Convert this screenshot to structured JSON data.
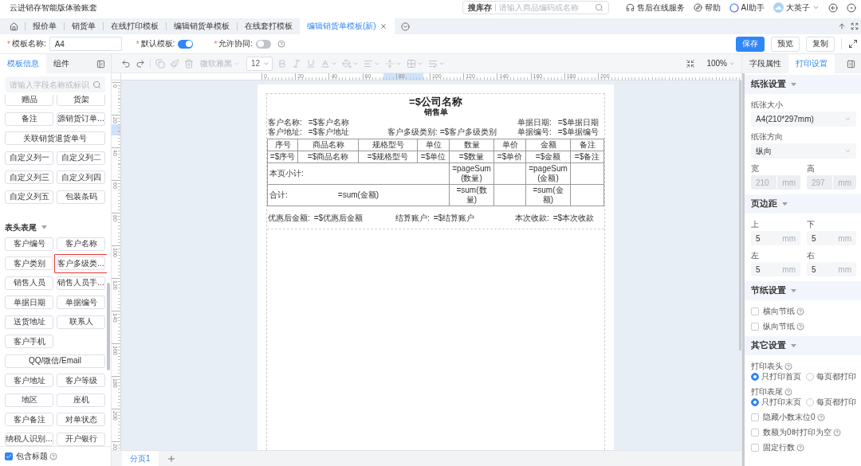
{
  "app": {
    "title": "云进销存智能版体验账套"
  },
  "header": {
    "search": {
      "scope": "搜库存",
      "placeholder": "请输入商品编码或名称"
    },
    "links": [
      {
        "label": "售后在线服务"
      },
      {
        "label": "帮助"
      },
      {
        "label": "AI助手"
      }
    ],
    "user": {
      "name": "大英子"
    }
  },
  "tabs": [
    {
      "label": "报价单",
      "selected": false
    },
    {
      "label": "销货单",
      "selected": false
    },
    {
      "label": "在线打印模板",
      "selected": false
    },
    {
      "label": "编辑销货单模板",
      "selected": false
    },
    {
      "label": "在线套打模板",
      "selected": false
    },
    {
      "label": "编辑销货单模板(新)",
      "selected": true
    }
  ],
  "template_form": {
    "fields": [
      {
        "kind": "input",
        "mark": "*",
        "label": "模板名称:",
        "value": "A4"
      },
      {
        "kind": "switch",
        "mark": "*",
        "label": "默认模板:",
        "on": true
      },
      {
        "kind": "switch",
        "mark": "*",
        "label": "允许协同:",
        "on": false,
        "help": true
      }
    ],
    "buttons": [
      {
        "label": "保存",
        "kind": "primary"
      },
      {
        "label": "预览",
        "kind": "default"
      },
      {
        "label": "复制",
        "kind": "default"
      }
    ]
  },
  "left_panel": {
    "tabs": [
      {
        "label": "模板信息",
        "selected": true
      },
      {
        "label": "组件",
        "selected": false
      }
    ],
    "search": {
      "placeholder": "请输入字段名称或标识"
    },
    "groups": [
      {
        "fields": [
          {
            "label": "赠品",
            "kind": "half",
            "highlighted": false
          },
          {
            "label": "货架",
            "kind": "half",
            "highlighted": false
          },
          {
            "label": "备注",
            "kind": "half",
            "highlighted": false
          },
          {
            "label": "源销货订单...",
            "kind": "half",
            "highlighted": false
          },
          {
            "label": "关联销货退货单号",
            "kind": "wide",
            "highlighted": false
          },
          {
            "label": "自定义列一",
            "kind": "half",
            "highlighted": false
          },
          {
            "label": "自定义列二",
            "kind": "half",
            "highlighted": false
          },
          {
            "label": "自定义列三",
            "kind": "half",
            "highlighted": false
          },
          {
            "label": "自定义列四",
            "kind": "half",
            "highlighted": false
          },
          {
            "label": "自定义列五",
            "kind": "half",
            "highlighted": false
          },
          {
            "label": "包装条码",
            "kind": "half",
            "highlighted": false
          }
        ]
      },
      {
        "title": "表头表尾",
        "expanded": true,
        "fields": [
          {
            "label": "客户编号",
            "kind": "half",
            "highlighted": false
          },
          {
            "label": "客户名称",
            "kind": "half",
            "highlighted": false
          },
          {
            "label": "客户类别",
            "kind": "half",
            "highlighted": false
          },
          {
            "label": "客户多级类...",
            "kind": "half",
            "highlighted": true
          },
          {
            "label": "销售人员",
            "kind": "half",
            "highlighted": false
          },
          {
            "label": "销售人员手...",
            "kind": "half",
            "highlighted": false
          },
          {
            "label": "单据日期",
            "kind": "half",
            "highlighted": false
          },
          {
            "label": "单据编号",
            "kind": "half",
            "highlighted": false
          },
          {
            "label": "送货地址",
            "kind": "half",
            "highlighted": false
          },
          {
            "label": "联系人",
            "kind": "half",
            "highlighted": false
          },
          {
            "label": "客户手机",
            "kind": "half",
            "highlighted": false
          },
          {
            "label": "QQ/微信/Email",
            "kind": "wide",
            "highlighted": false
          },
          {
            "label": "客户地址",
            "kind": "half",
            "highlighted": false
          },
          {
            "label": "客户等级",
            "kind": "half",
            "highlighted": false
          },
          {
            "label": "地区",
            "kind": "half",
            "highlighted": false
          },
          {
            "label": "座机",
            "kind": "half",
            "highlighted": false
          },
          {
            "label": "客户备注",
            "kind": "half",
            "highlighted": false
          },
          {
            "label": "对单状态",
            "kind": "half",
            "highlighted": false
          },
          {
            "label": "纳税人识别...",
            "kind": "half",
            "highlighted": false
          },
          {
            "label": "开户银行",
            "kind": "half",
            "highlighted": false
          }
        ]
      }
    ],
    "include_title": {
      "label": "包含标题",
      "checked": true,
      "help": true
    }
  },
  "editor": {
    "toolbar": {
      "font": {
        "value": "微软雅黑",
        "disabled": true
      },
      "size": "12",
      "zoom": "100%"
    },
    "rulers": {
      "horizontal": [
        "0",
        "20",
        "40",
        "60",
        "80",
        "100",
        "120",
        "140",
        "160",
        "180",
        "200"
      ],
      "vertical": [
        "0",
        "20",
        "40",
        "60",
        "80",
        "100",
        "120",
        "140",
        "160",
        "180",
        "200",
        "20"
      ]
    },
    "document": {
      "title": "=$公司名称",
      "subtitle": "销售单",
      "info_rows": [
        {
          "left": {
            "label": "客户名称:",
            "value": "=$客户名称"
          },
          "right": {
            "label": "单据日期:",
            "value": "=$单据日期"
          }
        },
        {
          "left": {
            "label": "客户地址:",
            "value": "=$客户地址"
          },
          "center": {
            "label": "客户多级类别:",
            "value": "=$客户多级类别"
          },
          "right": {
            "label": "单据编号:",
            "value": "=$单据编号"
          }
        }
      ],
      "table": {
        "columns": [
          "序号",
          "商品名称",
          "规格型号",
          "单位",
          "数量",
          "单价",
          "金额",
          "备注"
        ],
        "rows": [
          {
            "kind": "data",
            "cells": [
              "=$序号",
              "=$商品名称",
              "=$规格型号",
              "=$单位",
              "=$数量",
              "=$单价",
              "=$金额",
              "=$备注"
            ]
          },
          {
            "kind": "summary",
            "label": "本页小计:",
            "quantity": "=pageSum(数量)",
            "amount": "=pageSum(金额)"
          },
          {
            "kind": "summary",
            "label": "合计:",
            "label_value": "=sum(金额)",
            "quantity": "=sum(数量)",
            "amount": "=sum(金额)"
          }
        ]
      },
      "footer": [
        {
          "label": "优惠后金额:",
          "value": "=$优惠后金额"
        },
        {
          "label": "结算账户:",
          "value": "=$结算账户"
        },
        {
          "label": "本次收款:",
          "value": "=$本次收款"
        }
      ]
    },
    "page_tabs": [
      {
        "label": "分页1",
        "selected": true
      }
    ]
  },
  "right_panel": {
    "tabs": [
      {
        "label": "字段属性",
        "selected": false
      },
      {
        "label": "打印设置",
        "selected": true
      }
    ],
    "sections": [
      {
        "title": "纸张设置",
        "expanded": true,
        "items": [
          {
            "kind": "select",
            "label": "纸张大小",
            "value": "A4(210*297mm)"
          },
          {
            "kind": "select",
            "label": "纸张方向",
            "value": "纵向"
          },
          {
            "kind": "pair",
            "fields": [
              {
                "label": "宽",
                "value": "210",
                "unit": "mm",
                "disabled": true
              },
              {
                "label": "高",
                "value": "297",
                "unit": "mm",
                "disabled": true
              }
            ]
          }
        ]
      },
      {
        "title": "页边距",
        "expanded": true,
        "items": [
          {
            "kind": "pair",
            "fields": [
              {
                "label": "上",
                "value": "5",
                "unit": "mm",
                "disabled": false
              },
              {
                "label": "下",
                "value": "5",
                "unit": "mm",
                "disabled": false
              }
            ]
          },
          {
            "kind": "pair",
            "fields": [
              {
                "label": "左",
                "value": "5",
                "unit": "mm",
                "disabled": false
              },
              {
                "label": "右",
                "value": "5",
                "unit": "mm",
                "disabled": false
              }
            ]
          }
        ]
      },
      {
        "title": "节纸设置",
        "expanded": true,
        "items": [
          {
            "kind": "checkbox",
            "label": "横向节纸",
            "checked": false,
            "help": true
          },
          {
            "kind": "checkbox",
            "label": "纵向节纸",
            "checked": false,
            "help": true
          }
        ]
      },
      {
        "title": "其它设置",
        "expanded": true,
        "items": [
          {
            "kind": "radio",
            "label": "打印表头",
            "help": true,
            "options": [
              {
                "label": "只打印首页",
                "selected": true
              },
              {
                "label": "每页都打印",
                "selected": false
              }
            ]
          },
          {
            "kind": "radio",
            "label": "打印表尾",
            "help": true,
            "options": [
              {
                "label": "只打印末页",
                "selected": true
              },
              {
                "label": "每页都打印",
                "selected": false
              }
            ]
          },
          {
            "kind": "checkbox",
            "label": "隐藏小数末位0",
            "checked": false,
            "help": true
          },
          {
            "kind": "checkbox",
            "label": "数额为0时打印为空",
            "checked": false,
            "help": true
          },
          {
            "kind": "checkbox",
            "label": "固定行数",
            "checked": false,
            "help": true
          }
        ]
      }
    ]
  }
}
